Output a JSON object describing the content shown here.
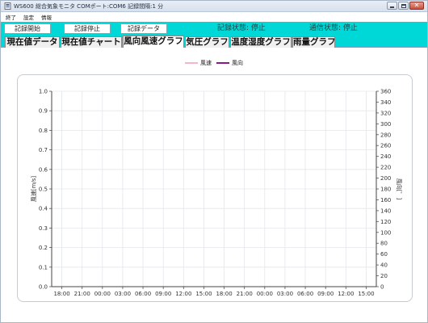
{
  "window": {
    "title": "WS600 総合気象モニタ COMポート:COM6 記録間隔:1 分"
  },
  "menu": {
    "items": [
      "終了",
      "設定",
      "情報"
    ]
  },
  "toolbar": {
    "record_start_label": "記録開始",
    "record_stop_label": "記録停止",
    "record_data_label": "記録データ",
    "record_status": "記録状態:  停止",
    "comm_status": "通信状態:  停止",
    "accent_color": "#00d7d7"
  },
  "tabs": [
    {
      "label": "現在値データ",
      "active": false
    },
    {
      "label": "現在値チャート",
      "active": false
    },
    {
      "label": "風向風速グラフ",
      "active": true
    },
    {
      "label": "気圧グラフ",
      "active": false
    },
    {
      "label": "温度湿度グラフ",
      "active": false
    },
    {
      "label": "雨量グラフ",
      "active": false
    }
  ],
  "chart_data": {
    "type": "line",
    "title": "",
    "xlabel": "",
    "ylabel": "風速[m/s]",
    "y2label": "風向[゜]",
    "ylim": [
      0,
      1.0
    ],
    "y2lim": [
      0,
      360
    ],
    "y_ticks": [
      "0.0",
      "0.1",
      "0.2",
      "0.3",
      "0.4",
      "0.5",
      "0.6",
      "0.7",
      "0.8",
      "0.9",
      "1.0"
    ],
    "y2_ticks": [
      "0",
      "20",
      "40",
      "60",
      "80",
      "100",
      "120",
      "140",
      "160",
      "180",
      "200",
      "220",
      "240",
      "260",
      "280",
      "300",
      "320",
      "340",
      "360"
    ],
    "x_ticks": [
      "18:00",
      "21:00",
      "00:00",
      "03:00",
      "06:00",
      "09:00",
      "12:00",
      "15:00",
      "18:00",
      "21:00",
      "00:00",
      "03:00",
      "06:00",
      "09:00",
      "12:00",
      "15:00"
    ],
    "grid": true,
    "legend_position": "top-center",
    "series": [
      {
        "name": "風速",
        "color": "#f4b6c8",
        "values": []
      },
      {
        "name": "風向",
        "color": "#8a1a8a",
        "values": []
      }
    ]
  }
}
